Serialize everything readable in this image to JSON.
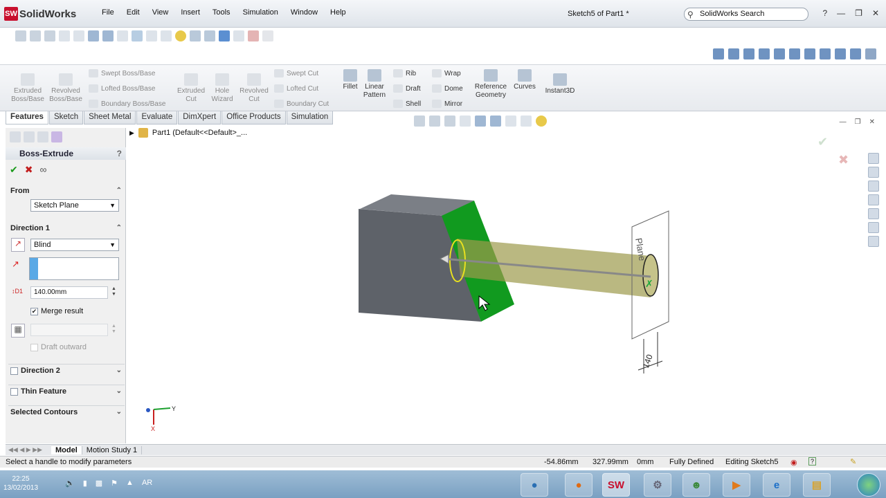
{
  "app": {
    "name": "SolidWorks",
    "logo_badge": "SW",
    "doc_title": "Sketch5 of Part1 *"
  },
  "menu": [
    "File",
    "Edit",
    "View",
    "Insert",
    "Tools",
    "Simulation",
    "Window",
    "Help"
  ],
  "search": {
    "placeholder": "SolidWorks Search"
  },
  "command_manager": {
    "extruded_boss": "Extruded Boss/Base",
    "revolved_boss": "Revolved Boss/Base",
    "swept_boss": "Swept Boss/Base",
    "lofted_boss": "Lofted Boss/Base",
    "boundary_boss": "Boundary Boss/Base",
    "extruded_cut": "Extruded Cut",
    "hole_wizard": "Hole Wizard",
    "revolved_cut": "Revolved Cut",
    "swept_cut": "Swept Cut",
    "lofted_cut": "Lofted Cut",
    "boundary_cut": "Boundary Cut",
    "fillet": "Fillet",
    "linear_pattern": "Linear Pattern",
    "rib": "Rib",
    "draft": "Draft",
    "shell": "Shell",
    "wrap": "Wrap",
    "dome": "Dome",
    "mirror": "Mirror",
    "reference_geometry": "Reference Geometry",
    "curves": "Curves",
    "instant3d": "Instant3D"
  },
  "tabs": [
    "Features",
    "Sketch",
    "Sheet Metal",
    "Evaluate",
    "DimXpert",
    "Office Products",
    "Simulation"
  ],
  "tree": {
    "part_label": "Part1  (Default<<Default>_..."
  },
  "property_manager": {
    "title": "Boss-Extrude",
    "help": "?",
    "from": {
      "heading": "From",
      "value": "Sketch Plane"
    },
    "direction1": {
      "heading": "Direction 1",
      "end_condition": "Blind",
      "depth": "140.00mm",
      "merge_result": "Merge result",
      "draft_outward": "Draft outward"
    },
    "direction2": {
      "heading": "Direction 2"
    },
    "thin_feature": {
      "heading": "Thin Feature"
    },
    "selected_contours": {
      "heading": "Selected Contours"
    }
  },
  "viewport": {
    "plane_label": "Plane",
    "dim_label": "140",
    "triad_y": "Y",
    "triad_x": "X"
  },
  "bottom_tabs": [
    "Model",
    "Motion Study 1"
  ],
  "status": {
    "message": "Select a handle to modify parameters",
    "x": "-54.86mm",
    "y": "327.99mm",
    "z": "0mm",
    "state": "Fully Defined",
    "editing": "Editing Sketch5"
  },
  "taskbar": {
    "time": "22:25",
    "date": "13/02/2013",
    "lang": "AR"
  },
  "colors": {
    "face_green": "#119a1f",
    "box_gray": "#5e6269",
    "extrude_preview": "#9c9a4c",
    "brand_red": "#c8102e"
  }
}
